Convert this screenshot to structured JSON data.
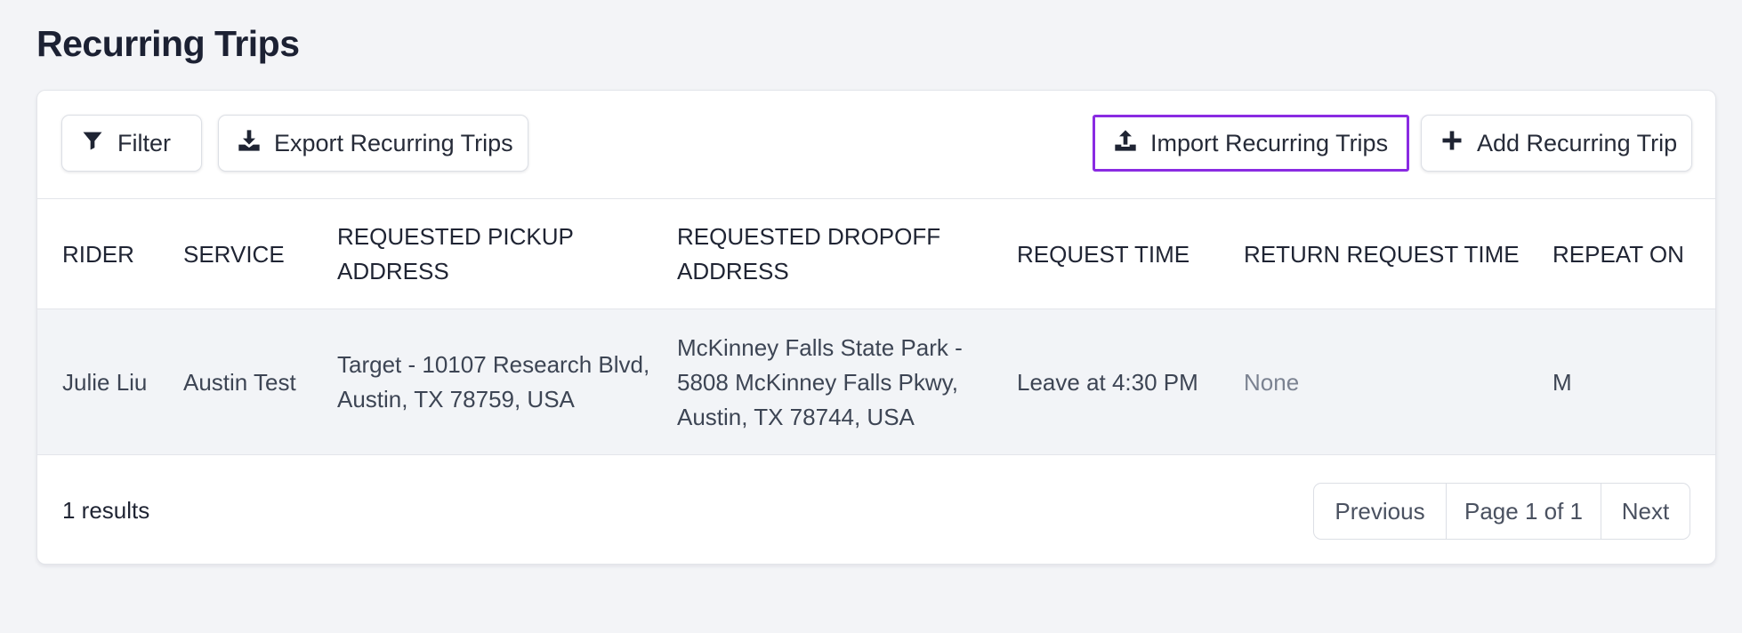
{
  "page": {
    "title": "Recurring Trips"
  },
  "toolbar": {
    "filter_label": "Filter",
    "export_label": "Export Recurring Trips",
    "import_label": "Import Recurring Trips",
    "add_label": "Add Recurring Trip",
    "icons": [
      "filter-icon",
      "download-icon",
      "upload-icon",
      "plus-icon"
    ],
    "highlight_color": "#8a2be2"
  },
  "table": {
    "columns": [
      "RIDER",
      "SERVICE",
      "REQUESTED PICKUP ADDRESS",
      "REQUESTED DROPOFF ADDRESS",
      "REQUEST TIME",
      "RETURN REQUEST TIME",
      "REPEAT ON"
    ],
    "rows": [
      {
        "rider": "Julie Liu",
        "service": "Austin Test",
        "pickup": "Target - 10107 Research Blvd, Austin, TX 78759, USA",
        "dropoff": "McKinney Falls State Park - 5808 McKinney Falls Pkwy, Austin, TX 78744, USA",
        "request_time": "Leave at 4:30 PM",
        "return_request_time": "None",
        "repeat_on": "M"
      }
    ]
  },
  "footer": {
    "results": "1 results",
    "previous_label": "Previous",
    "page_info": "Page 1 of 1",
    "next_label": "Next"
  }
}
